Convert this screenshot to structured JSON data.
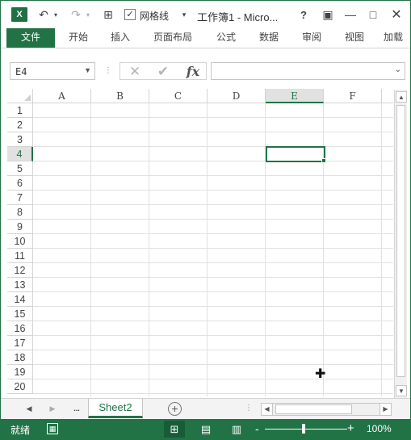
{
  "titlebar": {
    "app_icon": "X",
    "gridlines_checked": true,
    "gridlines_label": "网格线",
    "title": "工作簿1 - Micro...",
    "help": "?",
    "icons": [
      "excel-icon",
      "undo-icon",
      "redo-icon",
      "grid-icon",
      "checkbox-icon",
      "ribbon-display-icon",
      "minimize-icon",
      "maximize-icon",
      "close-icon"
    ]
  },
  "ribbon": {
    "tabs": [
      "文件",
      "开始",
      "插入",
      "页面布局",
      "公式",
      "数据",
      "审阅",
      "视图",
      "加载"
    ]
  },
  "formula_bar": {
    "name_box": "E4",
    "formula_value": "",
    "fx": "fx"
  },
  "sheet": {
    "columns": [
      "A",
      "B",
      "C",
      "D",
      "E",
      "F"
    ],
    "rows": [
      "1",
      "2",
      "3",
      "4",
      "5",
      "6",
      "7",
      "8",
      "9",
      "10",
      "11",
      "12",
      "13",
      "14",
      "15",
      "16",
      "17",
      "18",
      "19",
      "20"
    ],
    "selected_column": "E",
    "selected_row": "4",
    "active_cell": "E4"
  },
  "sheet_tabs": {
    "dots": "...",
    "active_sheet": "Sheet2",
    "add_sheet": "+"
  },
  "status": {
    "text": "就绪",
    "zoom_minus": "-",
    "zoom_plus": "+",
    "zoom_level": "100%"
  },
  "colors": {
    "accent": "#217346",
    "status_bar": "#217346",
    "gridline": "#e1e1e1"
  }
}
